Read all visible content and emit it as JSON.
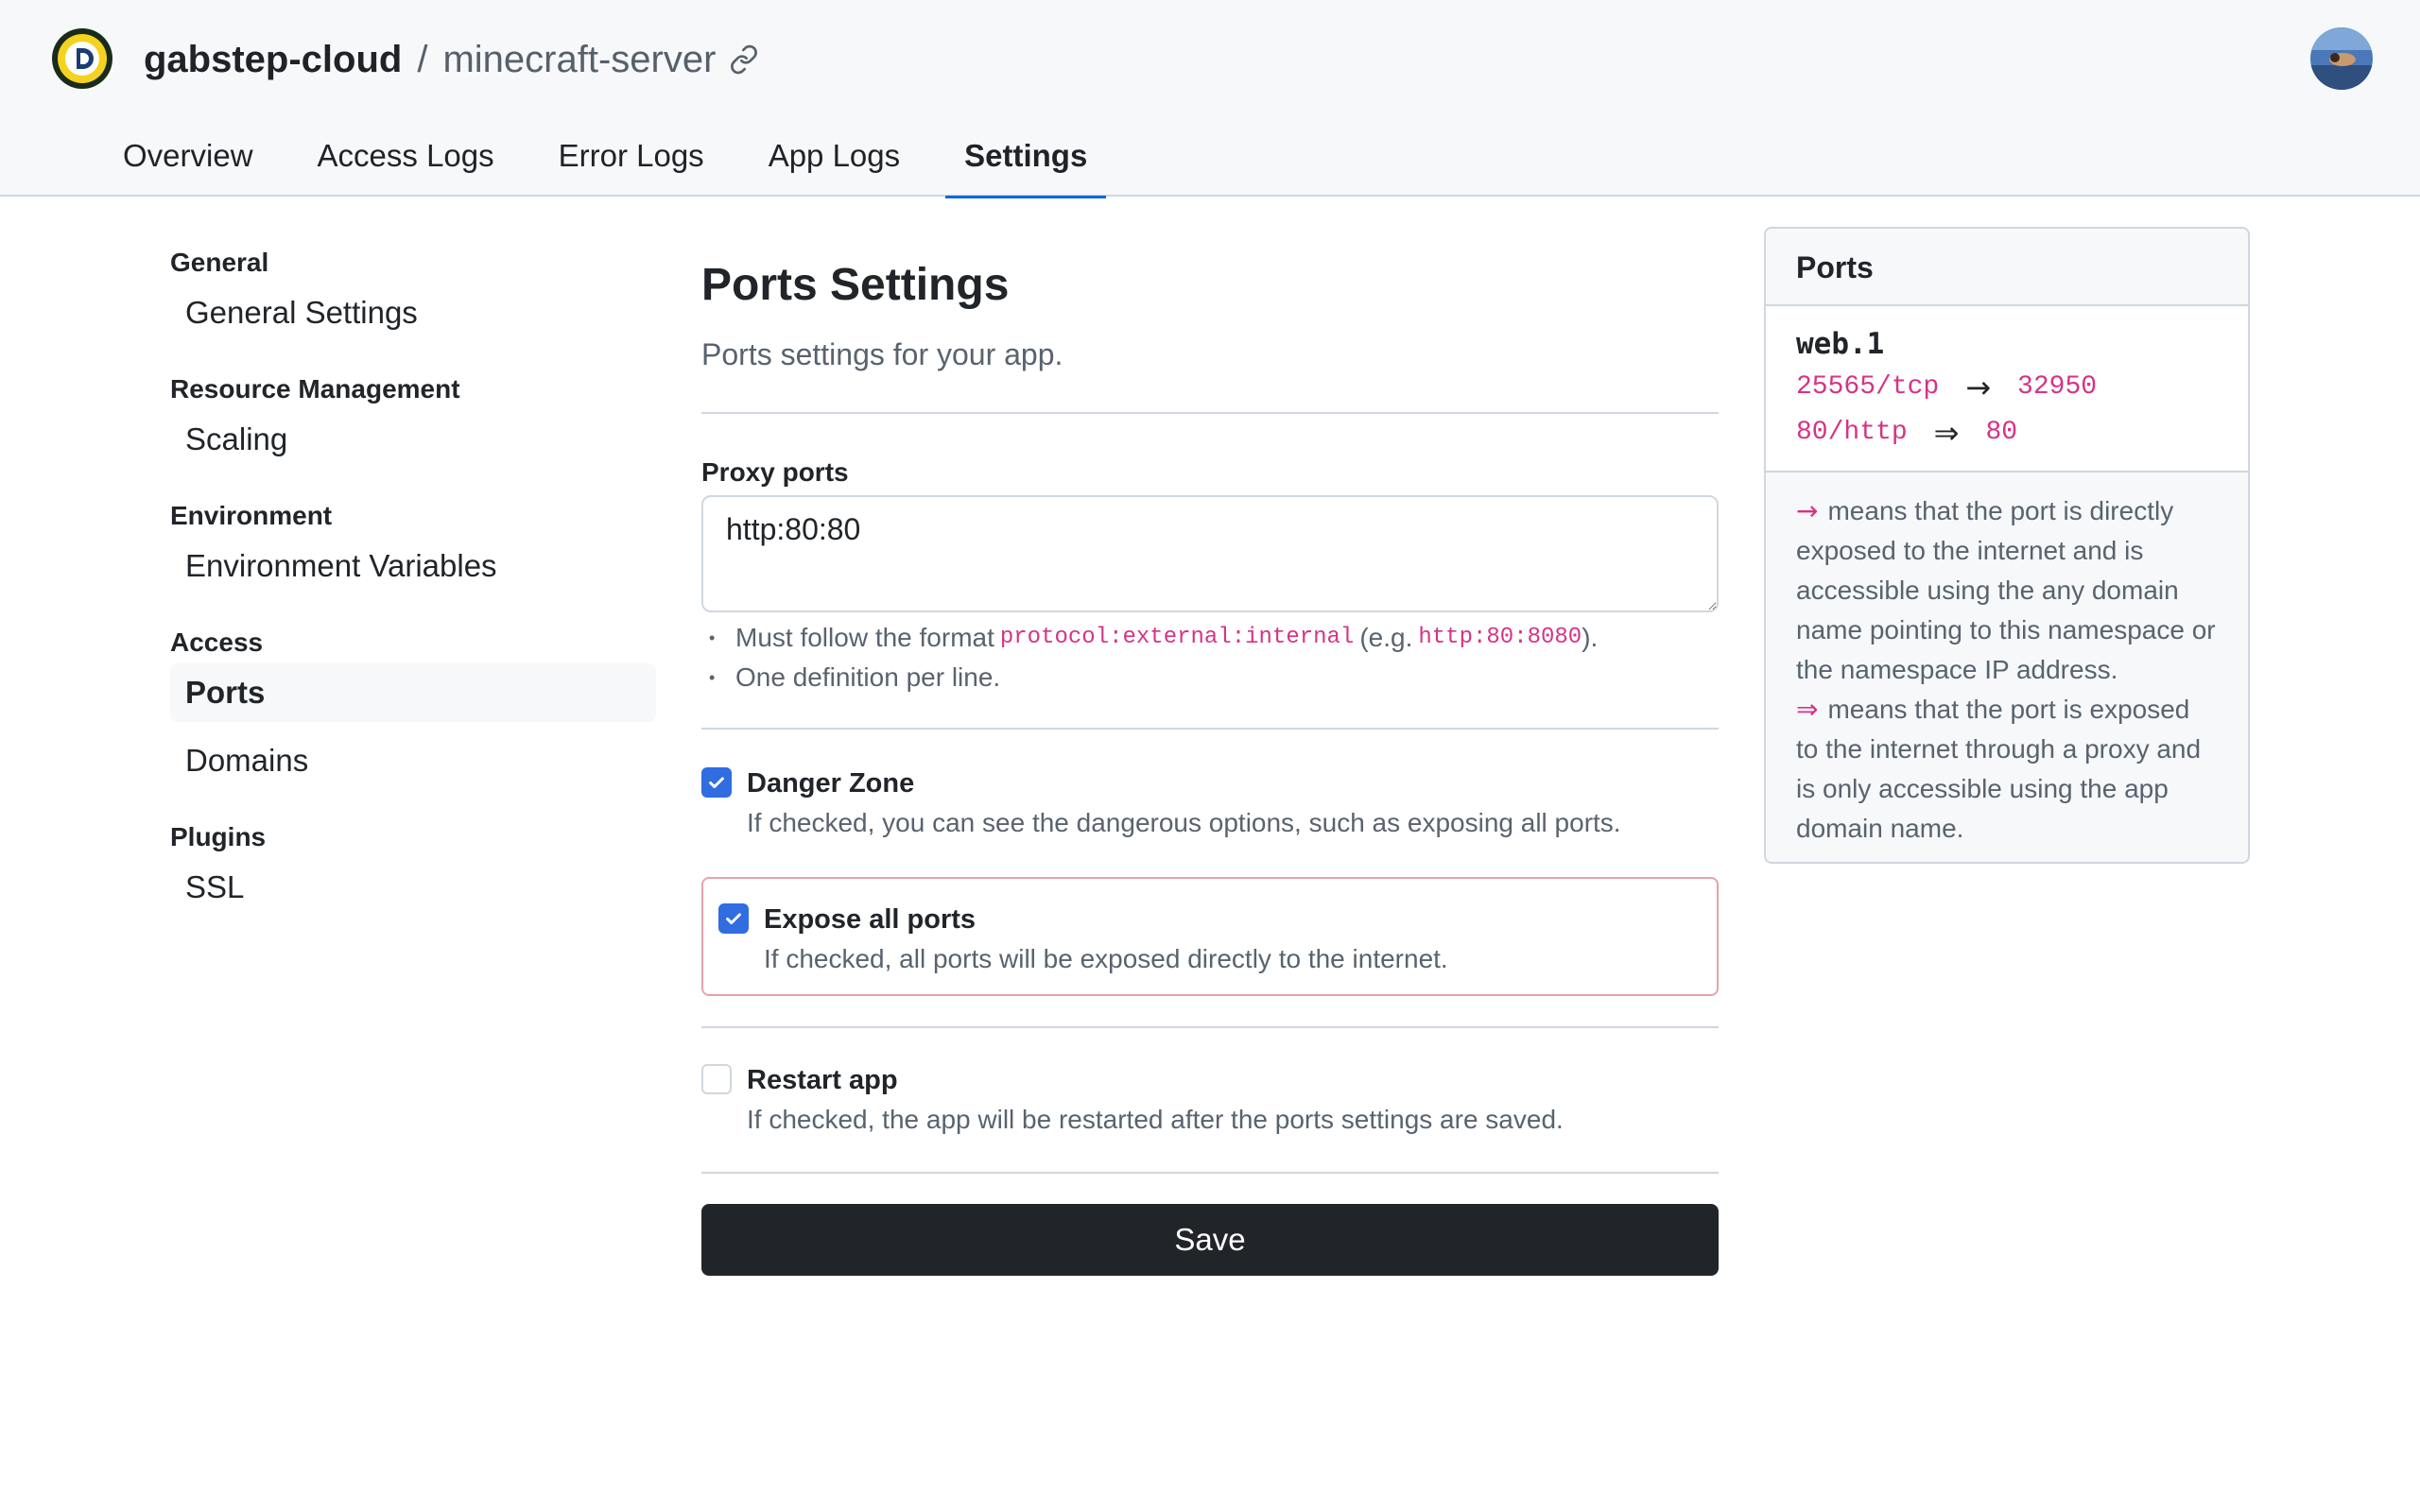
{
  "header": {
    "org": "gabstep-cloud",
    "separator": "/",
    "app": "minecraft-server"
  },
  "tabs": [
    {
      "label": "Overview"
    },
    {
      "label": "Access Logs"
    },
    {
      "label": "Error Logs"
    },
    {
      "label": "App Logs"
    },
    {
      "label": "Settings",
      "active": true
    }
  ],
  "sidebar": {
    "groups": [
      {
        "heading": "General",
        "items": [
          {
            "label": "General Settings"
          }
        ]
      },
      {
        "heading": "Resource Management",
        "items": [
          {
            "label": "Scaling"
          }
        ]
      },
      {
        "heading": "Environment",
        "items": [
          {
            "label": "Environment Variables"
          }
        ]
      },
      {
        "heading": "Access",
        "items": [
          {
            "label": "Ports",
            "active": true
          },
          {
            "label": "Domains"
          }
        ]
      },
      {
        "heading": "Plugins",
        "items": [
          {
            "label": "SSL"
          }
        ]
      }
    ]
  },
  "main": {
    "title": "Ports Settings",
    "subtitle": "Ports settings for your app.",
    "proxy_label": "Proxy ports",
    "proxy_value": "http:80:80",
    "hint1_prefix": "Must follow the format",
    "hint1_code": "protocol:external:internal",
    "hint1_mid": "(e.g.",
    "hint1_example": "http:80:8080",
    "hint1_suffix": ").",
    "hint2": "One definition per line.",
    "danger": {
      "title": "Danger Zone",
      "desc": "If checked, you can see the dangerous options, such as exposing all ports.",
      "checked": true
    },
    "expose": {
      "title": "Expose all ports",
      "desc": "If checked, all ports will be exposed directly to the internet.",
      "checked": true
    },
    "restart": {
      "title": "Restart app",
      "desc": "If checked, the app will be restarted after the ports settings are saved.",
      "checked": false
    },
    "save_label": "Save"
  },
  "panel": {
    "title": "Ports",
    "process": "web.1",
    "mappings": [
      {
        "from": "25565/tcp",
        "arrow": "→",
        "to": "32950"
      },
      {
        "from": "80/http",
        "arrow": "⇒",
        "to": "80"
      }
    ],
    "legend_direct_arrow": "→",
    "legend_direct": "means that the port is directly exposed to the internet and is accessible using the any domain name pointing to this namespace or the namespace IP address.",
    "legend_proxy_arrow": "⇒",
    "legend_proxy": "means that the port is exposed to the internet through a proxy and is only accessible using the app domain name."
  },
  "colors": {
    "accent": "#0969da",
    "checkbox": "#2f6de1",
    "code": "#d63384",
    "danger_border": "#e8a2aa",
    "button": "#212529"
  }
}
